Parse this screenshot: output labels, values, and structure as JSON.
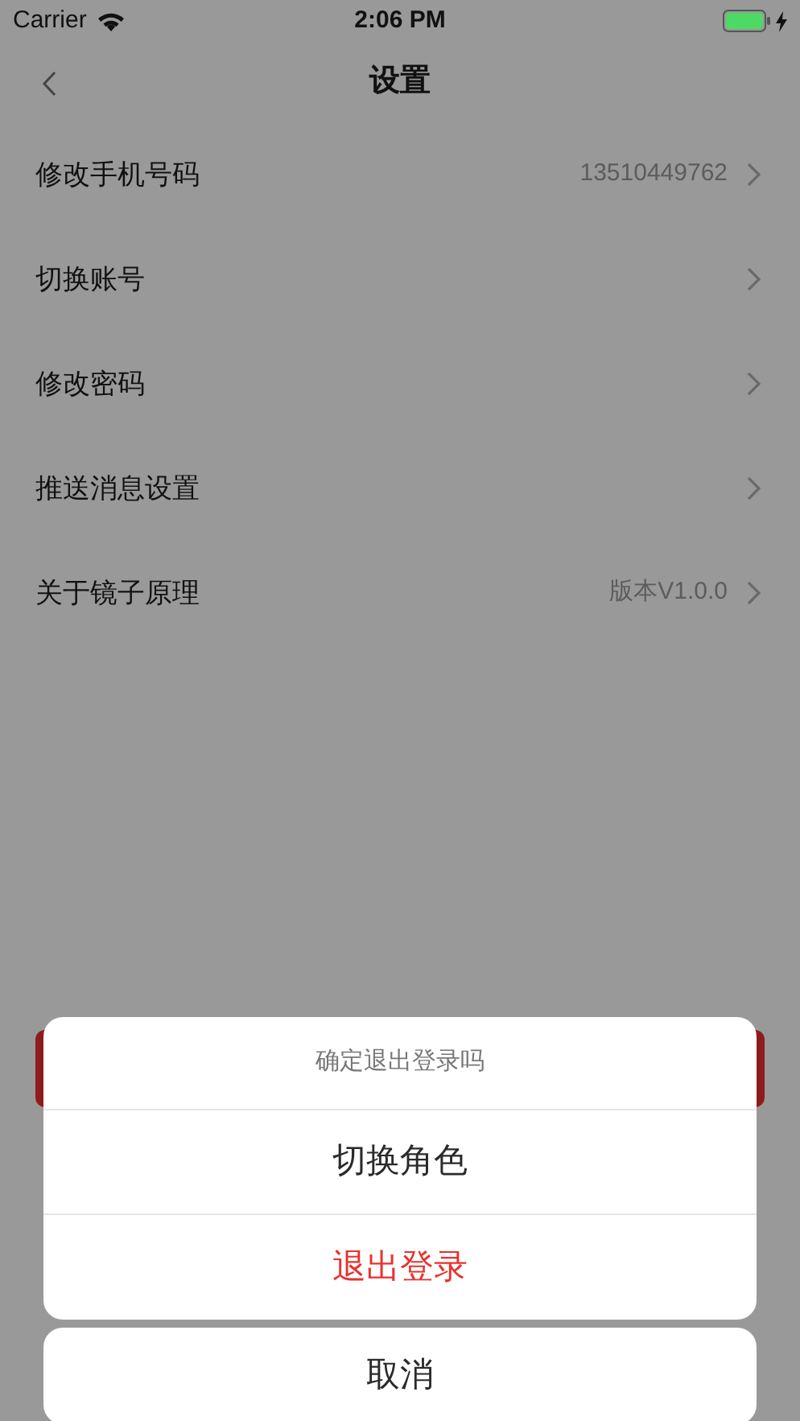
{
  "status_bar": {
    "carrier": "Carrier",
    "time": "2:06 PM",
    "charging": true
  },
  "nav": {
    "title": "设置"
  },
  "rows": [
    {
      "label": "修改手机号码",
      "value": "13510449762"
    },
    {
      "label": "切换账号"
    },
    {
      "label": "修改密码"
    },
    {
      "label": "推送消息设置"
    },
    {
      "label": "关于镜子原理",
      "value": "版本V1.0.0"
    }
  ],
  "action_sheet": {
    "message": "确定退出登录吗",
    "actions": [
      {
        "label": "切换角色",
        "kind": "normal"
      },
      {
        "label": "退出登录",
        "kind": "destructive"
      }
    ],
    "cancel": "取消"
  }
}
